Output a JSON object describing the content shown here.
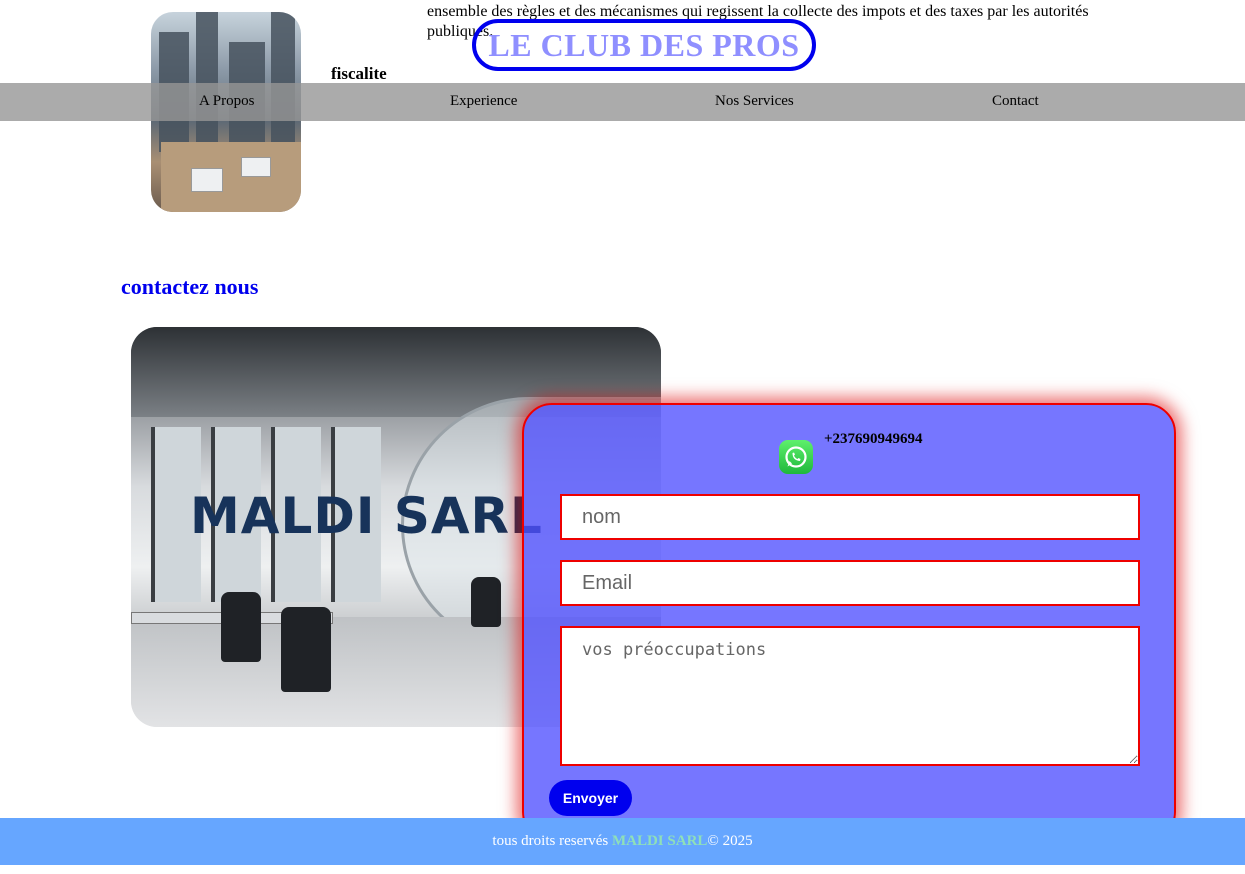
{
  "header": {
    "description": "ensemble des règles et des mécanismes qui regissent la collecte des impots et des taxes par les autorités publiques.",
    "topic": "fiscalite",
    "club_title": "LE CLUB DES PROS"
  },
  "nav": {
    "items": [
      {
        "label": "A Propos"
      },
      {
        "label": "Experience"
      },
      {
        "label": "Nos Services"
      },
      {
        "label": "Contact"
      }
    ]
  },
  "contact": {
    "title": "contactez nous",
    "brand_overlay": "MALDI SARL",
    "phone": "+237690949694",
    "whatsapp_icon": "whatsapp-icon",
    "name_placeholder": "nom",
    "email_placeholder": "Email",
    "message_placeholder": "vos préoccupations",
    "submit_label": "Envoyer"
  },
  "footer": {
    "prefix": "tous droits reservés ",
    "brand": "MALDI SARL",
    "suffix": "© 2025"
  },
  "colors": {
    "accent": "#0000ee",
    "nav_bg": "#969696",
    "card_bg": "#5050ff",
    "card_border": "#ee0000",
    "footer_bg": "#66a6ff"
  }
}
